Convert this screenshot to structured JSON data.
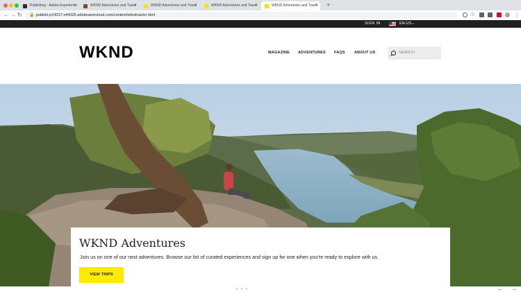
{
  "browser": {
    "tabs": [
      {
        "label": "Publishing - Adobe Experience",
        "favicon_color": "#2b2b2b",
        "active": false
      },
      {
        "label": "WKND Adventures and Travel",
        "favicon_color": "#7a4a2c",
        "active": false
      },
      {
        "label": "WKND Adventures and Travel",
        "favicon_color": "#ffe000",
        "active": false
      },
      {
        "label": "WKND Adventures and Travel",
        "favicon_color": "#ffe000",
        "active": false
      },
      {
        "label": "WKND Adventures and Travel",
        "favicon_color": "#ffe000",
        "active": true
      }
    ],
    "new_tab_glyph": "+",
    "url": "publish-p14317-e44326.adobeaemcloud.com/content/wknd/us/en.html"
  },
  "site": {
    "topbar": {
      "sign_in": "SIGN IN",
      "language": "EN-US"
    },
    "logo": "WKND",
    "nav": [
      "MAGAZINE",
      "ADVENTURES",
      "FAQS",
      "ABOUT US"
    ],
    "search_placeholder": "SEARCH"
  },
  "hero": {
    "title": "WKND Adventures",
    "description": "Join us on one of our next adventures. Browse our list of curated experiences and sign up for one when you're ready to explore with us.",
    "cta": "VIEW TRIPS"
  },
  "colors": {
    "accent": "#ffea00",
    "topbar": "#202020",
    "sky": "#c9dae9",
    "river": "#8fb2c4"
  }
}
